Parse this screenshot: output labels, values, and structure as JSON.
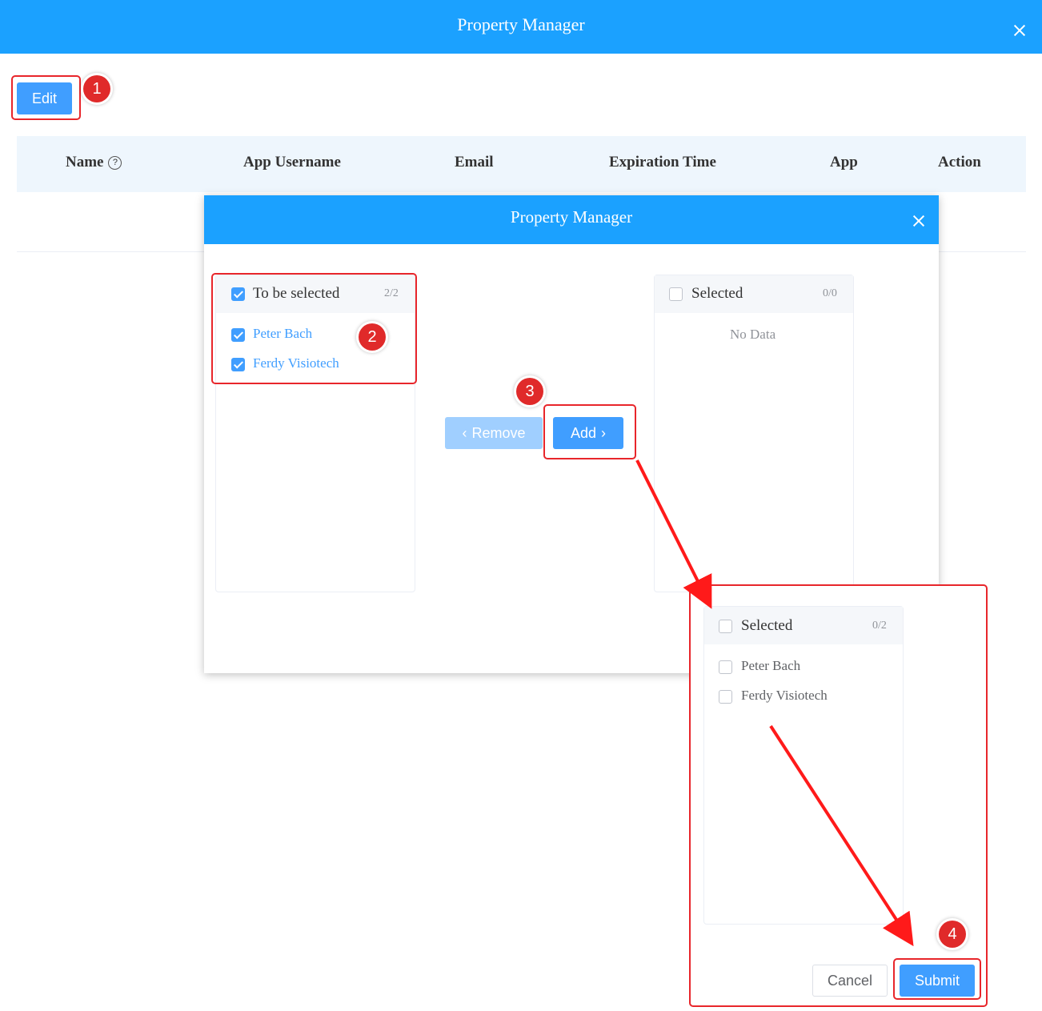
{
  "outer": {
    "title": "Property Manager",
    "edit_label": "Edit"
  },
  "table": {
    "columns": [
      "Name",
      "App Username",
      "Email",
      "Expiration Time",
      "App",
      "Action"
    ],
    "name_help_icon": "question-circle-icon"
  },
  "dialog": {
    "title": "Property Manager",
    "left_panel": {
      "title": "To be selected",
      "count": "2/2",
      "items": [
        "Peter Bach",
        "Ferdy Visiotech"
      ]
    },
    "right_panel": {
      "title": "Selected",
      "count": "0/0",
      "empty_text": "No Data"
    },
    "remove_label": "Remove",
    "add_label": "Add"
  },
  "result": {
    "panel": {
      "title": "Selected",
      "count": "0/2",
      "items": [
        "Peter Bach",
        "Ferdy Visiotech"
      ]
    },
    "cancel_label": "Cancel",
    "submit_label": "Submit"
  },
  "steps": [
    "1",
    "2",
    "3",
    "4"
  ],
  "colors": {
    "header_blue": "#1ba1ff",
    "primary": "#409eff",
    "annotation_red": "#e8262b"
  }
}
